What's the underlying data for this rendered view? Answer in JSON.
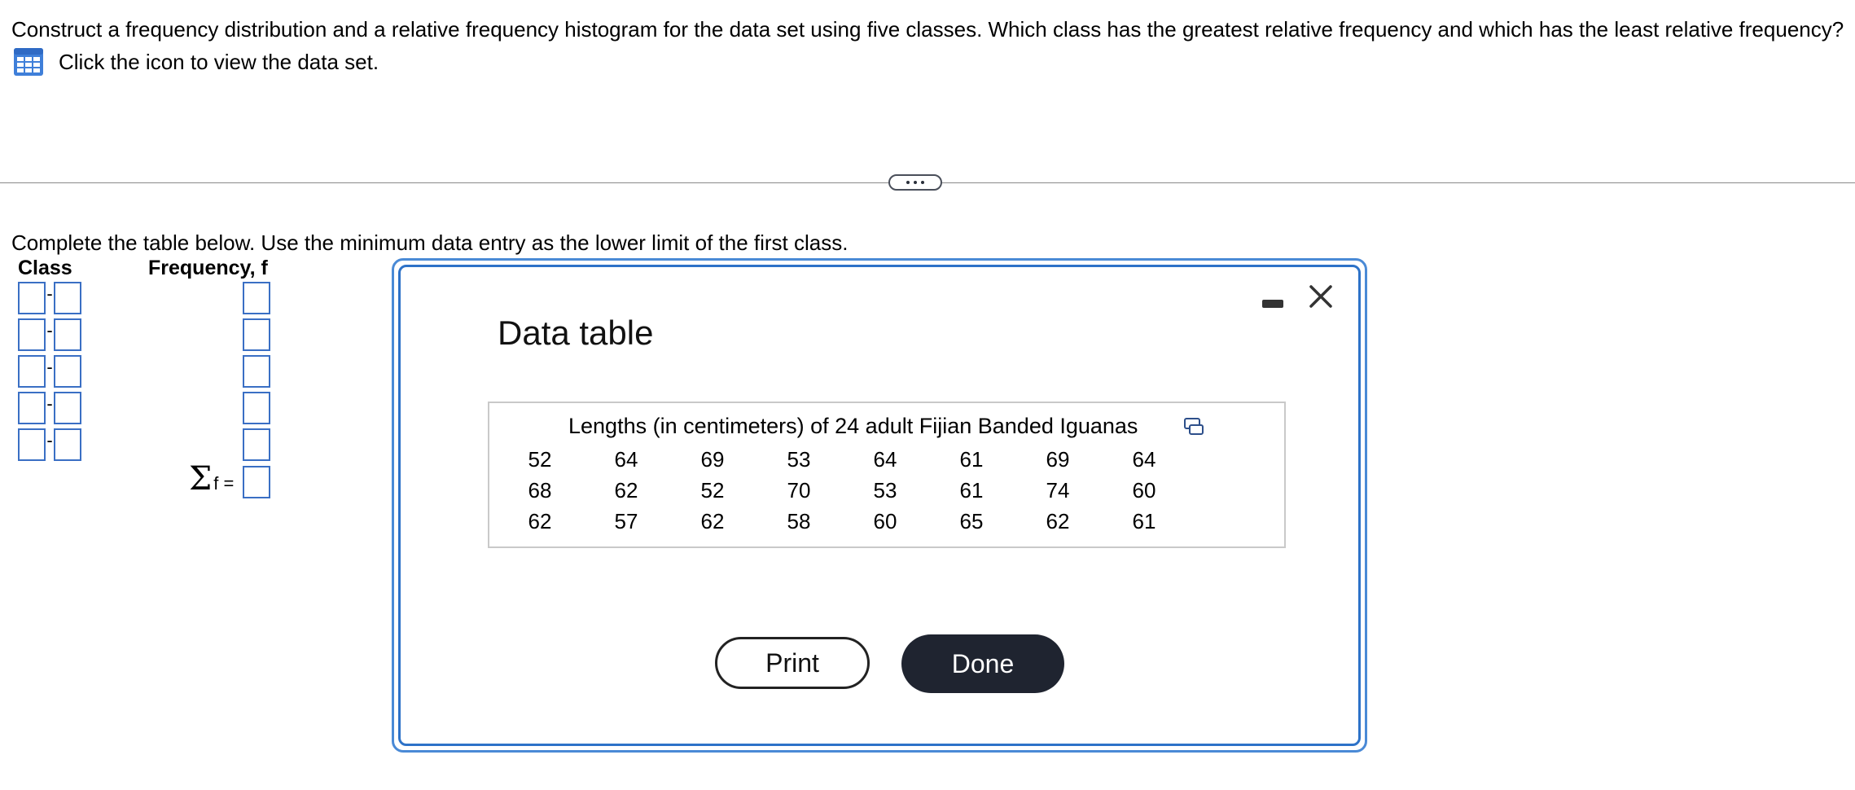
{
  "question": {
    "prompt": "Construct a frequency distribution and a relative frequency histogram for the data set using five classes. Which class has the greatest relative frequency and which has the least relative frequency?",
    "dataset_link_label": "Click the icon to view the data set.",
    "dataset_icon": "table-grid-icon"
  },
  "expand_button": {
    "icon": "ellipsis-icon"
  },
  "answer_area": {
    "instruction": "Complete the table below. Use the minimum data entry as the lower limit of the first class.",
    "class_header": "Class",
    "frequency_header": "Frequency, f",
    "class_separator": "-",
    "rows": [
      {
        "lower": "",
        "upper": "",
        "frequency": ""
      },
      {
        "lower": "",
        "upper": "",
        "frequency": ""
      },
      {
        "lower": "",
        "upper": "",
        "frequency": ""
      },
      {
        "lower": "",
        "upper": "",
        "frequency": ""
      },
      {
        "lower": "",
        "upper": "",
        "frequency": ""
      }
    ],
    "sum_symbol": "Σ",
    "sum_label": "f =",
    "sum_value": ""
  },
  "modal": {
    "title": "Data table",
    "caption": "Lengths (in centimeters) of 24 adult Fijian Banded Iguanas",
    "data_rows": [
      [
        "52",
        "64",
        "69",
        "53",
        "64",
        "61",
        "69",
        "64"
      ],
      [
        "68",
        "62",
        "52",
        "70",
        "53",
        "61",
        "74",
        "60"
      ],
      [
        "62",
        "57",
        "62",
        "58",
        "60",
        "65",
        "62",
        "61"
      ]
    ],
    "print_label": "Print",
    "done_label": "Done",
    "minimize_icon": "minimize-icon",
    "close_icon": "close-icon",
    "copy_icon": "copy-icon",
    "colors": {
      "border": "#2d72c8",
      "done_bg": "#1f2430",
      "input_border": "#3a6fc4"
    }
  }
}
